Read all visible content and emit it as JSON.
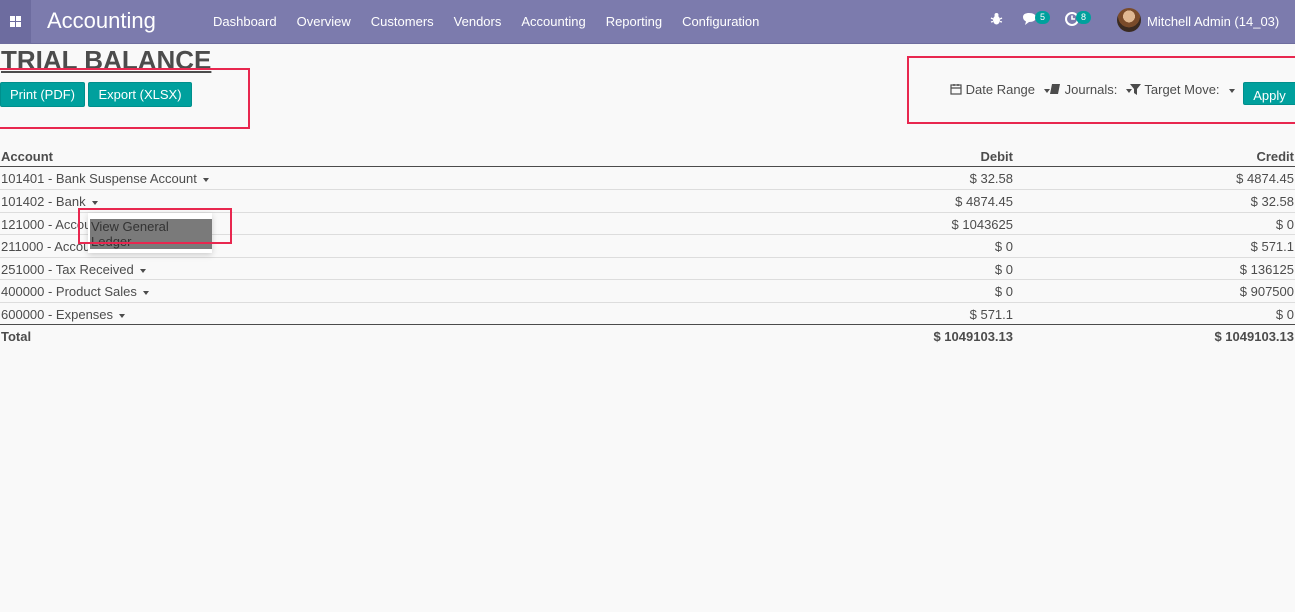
{
  "navbar": {
    "brand": "Accounting",
    "menu": [
      "Dashboard",
      "Overview",
      "Customers",
      "Vendors",
      "Accounting",
      "Reporting",
      "Configuration"
    ],
    "messages_count": "5",
    "activities_count": "8",
    "user_name": "Mitchell Admin (14_03)",
    "accent_color": "#7c7bad"
  },
  "report": {
    "title": "TRIAL BALANCE",
    "print_label": "Print (PDF)",
    "export_label": "Export (XLSX)",
    "filters": {
      "date_range": "Date Range",
      "journals": "Journals:",
      "target_move": "Target Move:",
      "apply": "Apply"
    }
  },
  "table": {
    "headers": {
      "account": "Account",
      "debit": "Debit",
      "credit": "Credit"
    },
    "rows": [
      {
        "account": "101401 - Bank Suspense Account",
        "debit": "$ 32.58",
        "credit": "$ 4874.45"
      },
      {
        "account": "101402 - Bank",
        "debit": "$ 4874.45",
        "credit": "$ 32.58"
      },
      {
        "account": "121000 - Accou",
        "debit": "$ 1043625",
        "credit": "$ 0"
      },
      {
        "account": "211000 - Accou",
        "debit": "$ 0",
        "credit": "$ 571.1"
      },
      {
        "account": "251000 - Tax Received",
        "debit": "$ 0",
        "credit": "$ 136125"
      },
      {
        "account": "400000 - Product Sales",
        "debit": "$ 0",
        "credit": "$ 907500"
      },
      {
        "account": "600000 - Expenses",
        "debit": "$ 571.1",
        "credit": "$ 0"
      }
    ],
    "total": {
      "label": "Total",
      "debit": "$ 1049103.13",
      "credit": "$ 1049103.13"
    }
  },
  "popup": {
    "item": "View General Ledger"
  },
  "colors": {
    "button": "#00a09d",
    "annotation": "#e8274f"
  }
}
